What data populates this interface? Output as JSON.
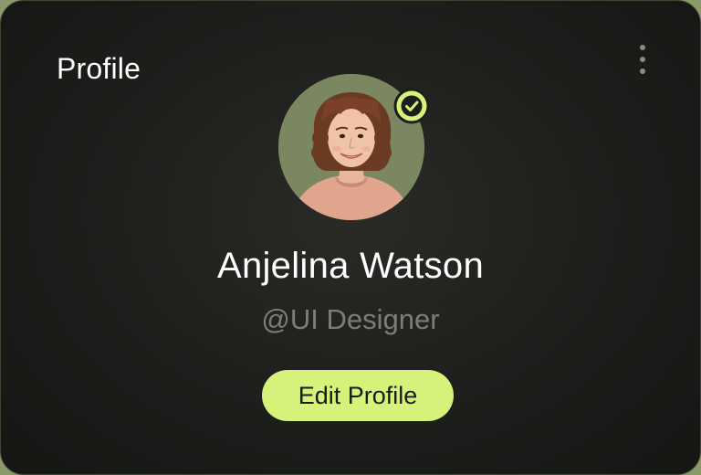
{
  "card": {
    "title": "Profile",
    "menu_icon": "more-vertical-icon"
  },
  "profile": {
    "name": "Anjelina Watson",
    "handle": "@UI Designer",
    "avatar_alt": "Anjelina Watson",
    "verified_icon": "check-circle-icon"
  },
  "actions": {
    "edit_label": "Edit Profile"
  },
  "colors": {
    "accent": "#d6f27a",
    "card_bg": "#1d1e1b",
    "avatar_bg": "#7b8761",
    "muted_text": "#7c7d79"
  }
}
